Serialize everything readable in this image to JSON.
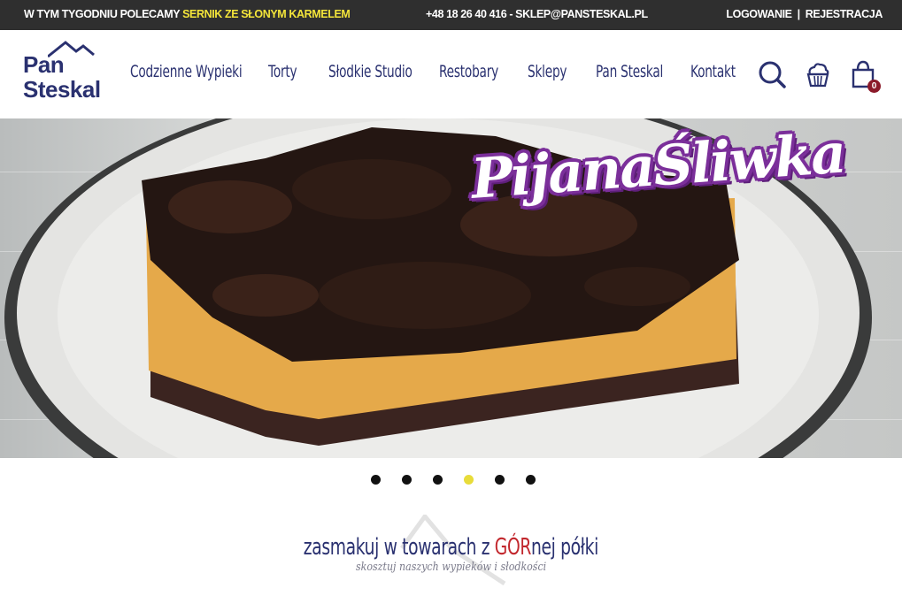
{
  "topbar": {
    "promo_prefix": "W TYM TYGODNIU POLECAMY",
    "promo_highlight": "SERNIK ZE SŁONYM KARMELEM",
    "contact": "+48 18 26 40 416 - SKLEP@PANSTESKAL.PL",
    "login": "LOGOWANIE",
    "separator": "|",
    "register": "REJESTRACJA"
  },
  "logo": {
    "line1": "Pan",
    "line2": "Steskal"
  },
  "nav": {
    "items": [
      {
        "label": "Codzienne Wypieki"
      },
      {
        "label": "Torty"
      },
      {
        "label": "Słodkie Studio"
      },
      {
        "label": "Restobary"
      },
      {
        "label": "Sklepy"
      },
      {
        "label": "Pan Steskal"
      },
      {
        "label": "Kontakt"
      }
    ]
  },
  "icons": {
    "search": "search-icon",
    "cupcake": "cupcake-icon",
    "cart": "shopping-bag-icon"
  },
  "cart": {
    "count": "0"
  },
  "hero": {
    "title": "PijanaŚliwka"
  },
  "slider": {
    "count": 6,
    "active_index": 3
  },
  "tagline": {
    "prefix": "zasmakuj w towarach z ",
    "accent": "GÓR",
    "suffix": "nej półki",
    "sub": "skosztuj naszych wypieków i słodkości"
  },
  "colors": {
    "topbar_bg": "#2f2f2f",
    "highlight": "#f4e53a",
    "brand_navy": "#2a3170",
    "accent_red": "#c2272d",
    "badge": "#8b1a2a",
    "hero_title_outline": "#7b2f9a",
    "dot_active": "#e8dc3a"
  }
}
